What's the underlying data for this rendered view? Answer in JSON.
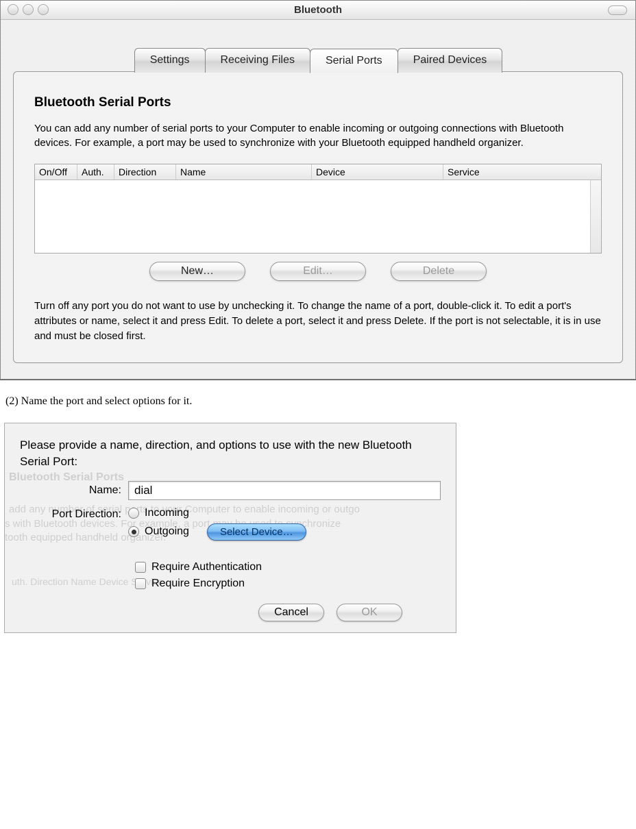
{
  "window": {
    "title": "Bluetooth",
    "tabs": [
      {
        "label": "Settings"
      },
      {
        "label": "Receiving Files"
      },
      {
        "label": "Serial Ports"
      },
      {
        "label": "Paired Devices"
      }
    ],
    "active_tab_index": 2,
    "pane": {
      "heading": "Bluetooth Serial Ports",
      "description": "You can add any number of serial ports to your Computer to enable incoming or outgoing connections with Bluetooth devices.  For example, a port may be used to synchronize with your Bluetooth equipped handheld organizer.",
      "columns": {
        "onoff": "On/Off",
        "auth": "Auth.",
        "direction": "Direction",
        "name": "Name",
        "device": "Device",
        "service": "Service"
      },
      "rows": [],
      "buttons": {
        "new": "New…",
        "edit": "Edit…",
        "delete": "Delete"
      },
      "hint": "Turn off any port you do not want to use by unchecking it. To change the name of a port, double-click it. To edit a port's attributes or name, select it and press Edit. To delete a port, select it and press Delete. If the port is not selectable, it is in use and must be closed first."
    }
  },
  "caption": "(2) Name the port and select options for it.",
  "dialog": {
    "prompt": "Please provide a name, direction, and options to use with the new Bluetooth Serial Port:",
    "name_label": "Name:",
    "name_value": "dial",
    "direction_label": "Port Direction:",
    "direction_options": {
      "incoming": "Incoming",
      "outgoing": "Outgoing"
    },
    "direction_selected": "outgoing",
    "select_device": "Select Device…",
    "require_auth": "Require Authentication",
    "require_enc": "Require Encryption",
    "require_auth_checked": false,
    "require_enc_checked": false,
    "cancel": "Cancel",
    "ok": "OK",
    "ghost": {
      "heading": "Bluetooth Serial Ports",
      "line1": "add any number of serial ports to your Computer to enable incoming or outgo",
      "line2": "s with Bluetooth devices.  For example, a port may be used to synchronize",
      "line3": "tooth equipped handheld organizer.",
      "cols": "uth.    Direction   Name                     Device                Service"
    }
  }
}
